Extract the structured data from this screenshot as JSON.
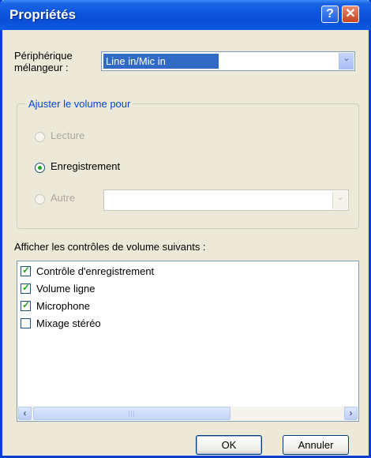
{
  "window": {
    "title": "Propriétés",
    "help_glyph": "?",
    "close_glyph": "✕"
  },
  "mixer": {
    "label_line1": "Périphérique",
    "label_line2": "mélangeur :",
    "selected": "Line in/Mic in",
    "arrow": "⌄"
  },
  "adjust_group": {
    "title": "Ajuster le volume pour",
    "options": [
      {
        "label": "Lecture",
        "selected": false,
        "enabled": false
      },
      {
        "label": "Enregistrement",
        "selected": true,
        "enabled": true
      },
      {
        "label": "Autre",
        "selected": false,
        "enabled": false
      }
    ],
    "other_arrow": "⌄"
  },
  "controls": {
    "label": "Afficher les contrôles de volume suivants :",
    "items": [
      {
        "label": "Contrôle d'enregistrement",
        "checked": true
      },
      {
        "label": "Volume ligne",
        "checked": true
      },
      {
        "label": "Microphone",
        "checked": true
      },
      {
        "label": "Mixage stéréo",
        "checked": false
      }
    ],
    "check_glyph": "✓",
    "scroll_left": "‹",
    "scroll_right": "›",
    "thumb_grip": "|||"
  },
  "buttons": {
    "ok": "OK",
    "cancel": "Annuler"
  },
  "colors": {
    "titlebar": "#0a4fd6",
    "dialog_bg": "#ece9d8",
    "selection": "#316ac5",
    "group_title": "#0046d5",
    "check": "#21a121"
  }
}
